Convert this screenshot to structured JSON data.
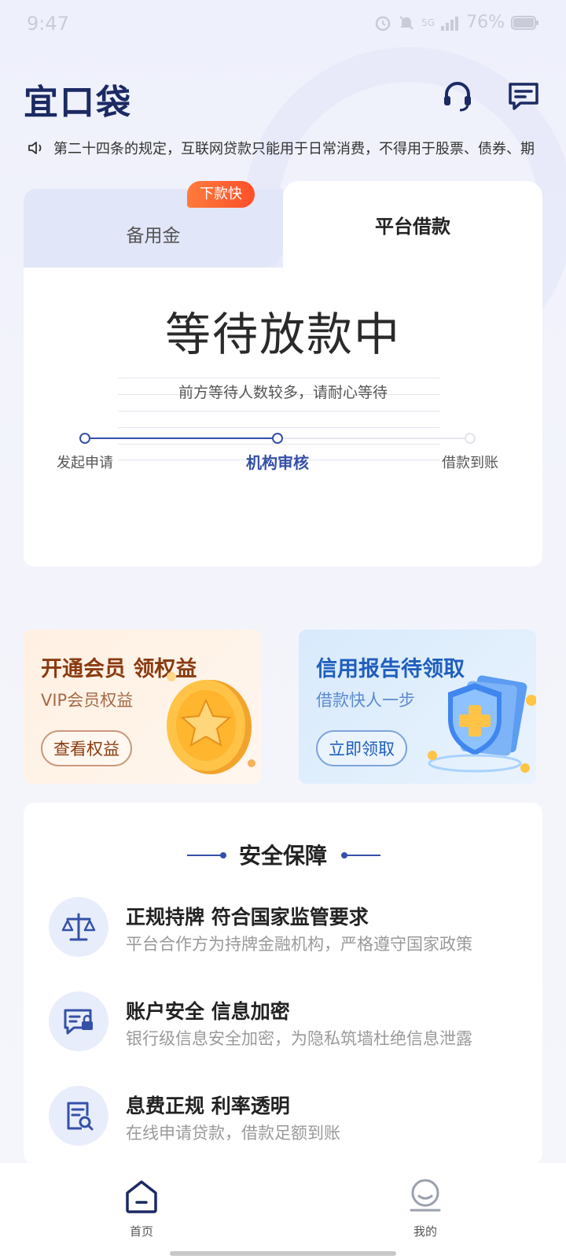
{
  "status_bar": {
    "time": "9:47",
    "network": "5G",
    "battery": "76%"
  },
  "header": {
    "logo": "宜口袋"
  },
  "notice": {
    "text": "第二十四条的规定，互联网贷款只能用于日常消费，不得用于股票、债券、期"
  },
  "loan_card": {
    "tab_standby": "备用金",
    "tab_badge": "下款快",
    "tab_platform": "平台借款",
    "status_title": "等待放款中",
    "status_subtitle": "前方等待人数较多，请耐心等待",
    "steps": [
      {
        "label": "发起申请",
        "state": "done"
      },
      {
        "label": "机构审核",
        "state": "current"
      },
      {
        "label": "借款到账",
        "state": "pending"
      }
    ]
  },
  "promos": {
    "vip": {
      "title": "开通会员 领权益",
      "subtitle": "VIP会员权益",
      "button": "查看权益"
    },
    "credit": {
      "title": "信用报告待领取",
      "subtitle": "借款快人一步",
      "button": "立即领取"
    }
  },
  "security": {
    "title": "安全保障",
    "items": [
      {
        "title": "正规持牌 符合国家监管要求",
        "desc": "平台合作方为持牌金融机构，严格遵守国家政策",
        "icon": "scale-icon"
      },
      {
        "title": "账户安全 信息加密",
        "desc": "银行级信息安全加密，为隐私筑墙杜绝信息泄露",
        "icon": "secure-message-icon"
      },
      {
        "title": "息费正规  利率透明",
        "desc": "在线申请贷款，借款足额到账",
        "icon": "document-search-icon"
      }
    ]
  },
  "bottom_nav": {
    "home": "首页",
    "mine": "我的"
  },
  "colors": {
    "brand": "#1b2a63",
    "accent": "#3550a8",
    "badge": "#ff5a2c"
  }
}
